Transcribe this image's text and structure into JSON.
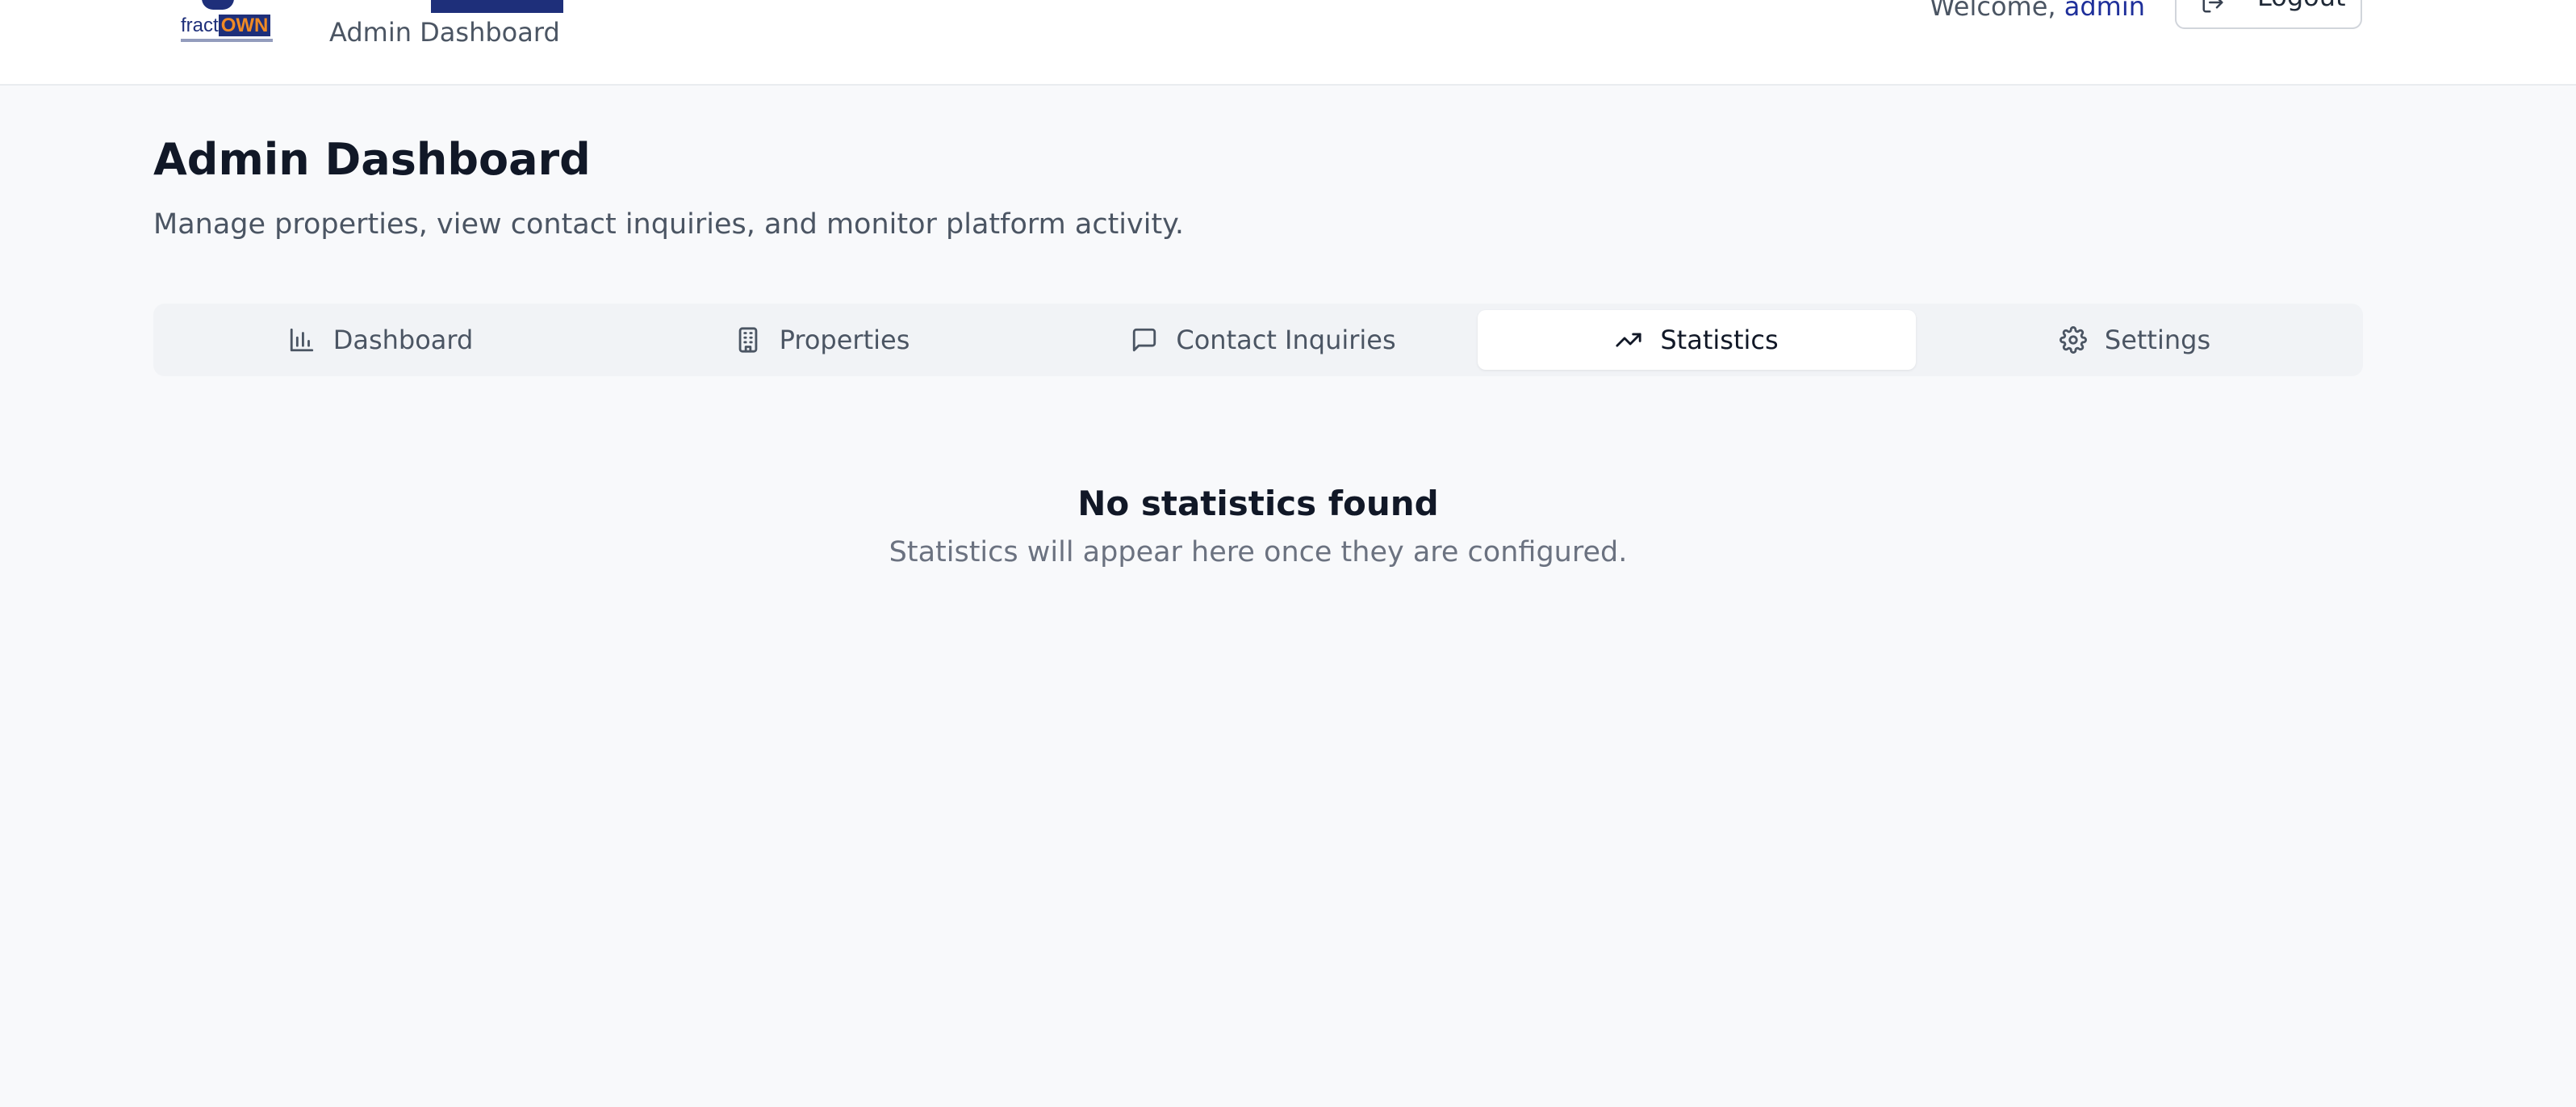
{
  "header": {
    "logo": {
      "brand_prefix": "fract",
      "brand_suffix": "OWN"
    },
    "subtitle": "Admin Dashboard",
    "welcome_prefix": "Welcome, ",
    "username": "admin",
    "logout_label": "Logout",
    "logout_icon": "logout-icon"
  },
  "page": {
    "title": "Admin Dashboard",
    "description": "Manage properties, view contact inquiries, and monitor platform activity."
  },
  "tabs": [
    {
      "label": "Dashboard",
      "icon": "bar-chart-icon",
      "active": false
    },
    {
      "label": "Properties",
      "icon": "building-icon",
      "active": false
    },
    {
      "label": "Contact Inquiries",
      "icon": "message-icon",
      "active": false
    },
    {
      "label": "Statistics",
      "icon": "trending-up-icon",
      "active": true
    },
    {
      "label": "Settings",
      "icon": "gear-icon",
      "active": false
    }
  ],
  "empty_state": {
    "title": "No statistics found",
    "text": "Statistics will appear here once they are configured."
  },
  "colors": {
    "brand": "#1e2f7a",
    "accent": "#f08a24",
    "background": "#f8f9fb"
  }
}
